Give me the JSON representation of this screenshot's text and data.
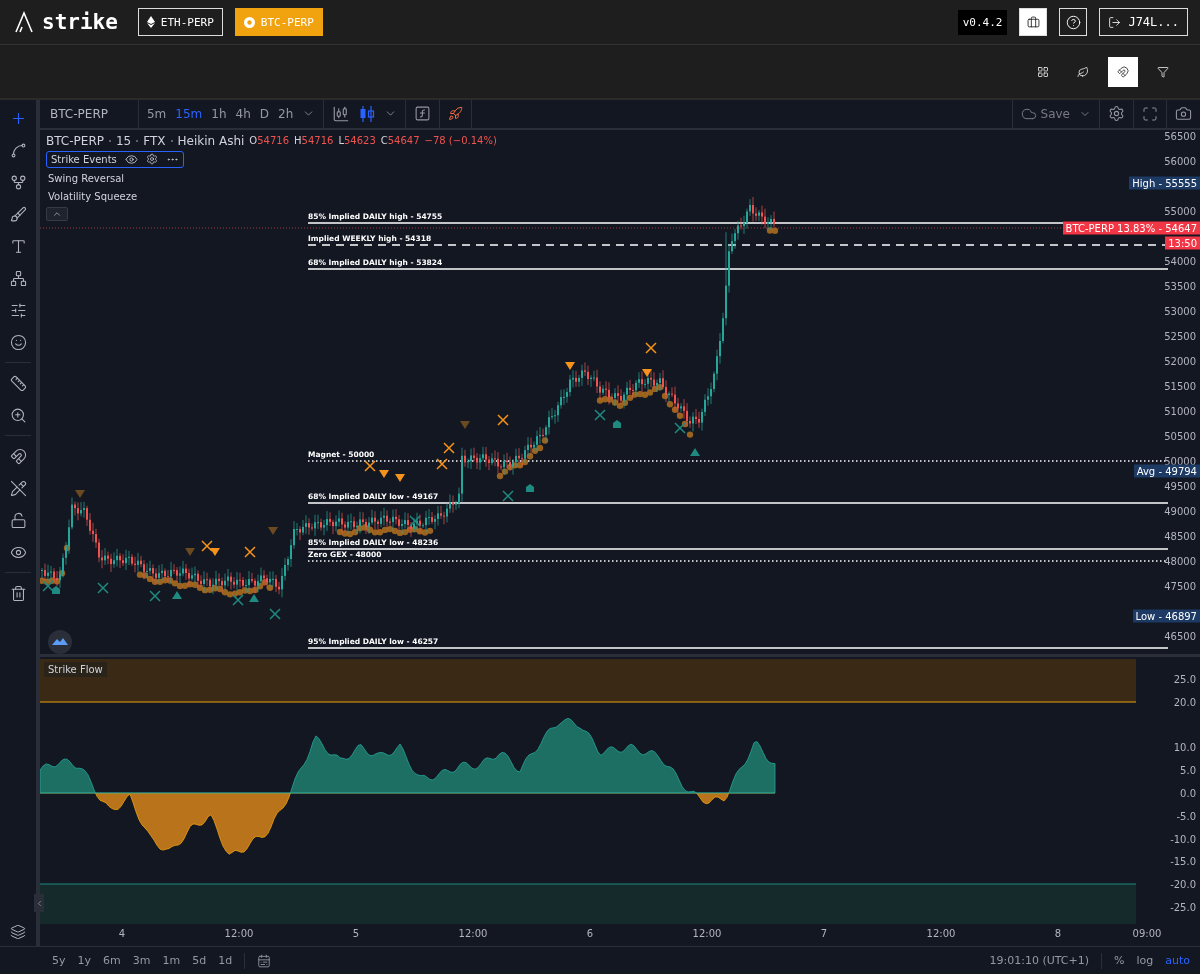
{
  "header": {
    "logo": "strike",
    "markets": [
      {
        "kind": "eth",
        "label": "ETH-PERP",
        "selected": false
      },
      {
        "kind": "btc",
        "label": "BTC-PERP",
        "selected": true
      }
    ],
    "version": "v0.4.2",
    "account": "J74L..."
  },
  "subbar": {
    "tools": [
      {
        "kind": "grid",
        "selected": false
      },
      {
        "kind": "leaf",
        "selected": false
      },
      {
        "kind": "magnet",
        "selected": true
      },
      {
        "kind": "filter",
        "selected": false
      }
    ]
  },
  "left_tools": [
    {
      "kind": "crosshair",
      "selected": true
    },
    {
      "kind": "trend-line",
      "selected": false
    },
    {
      "kind": "pitchfork",
      "selected": false
    },
    {
      "kind": "brush",
      "selected": false
    },
    {
      "kind": "text",
      "selected": false
    },
    {
      "kind": "pattern",
      "selected": false
    },
    {
      "kind": "forecast",
      "selected": false
    },
    {
      "kind": "emoji",
      "selected": false
    },
    {
      "kind": "ruler",
      "selected": false
    },
    {
      "kind": "zoom",
      "selected": false
    },
    {
      "kind": "magnet",
      "selected": false
    },
    {
      "kind": "lock-drawing",
      "selected": false
    },
    {
      "kind": "lock",
      "selected": false
    },
    {
      "kind": "eye",
      "selected": false
    },
    {
      "kind": "trash",
      "selected": false
    }
  ],
  "chart_toolbar": {
    "symbol": "BTC-PERP",
    "intervals": [
      {
        "label": "5m",
        "selected": false
      },
      {
        "label": "15m",
        "selected": true
      },
      {
        "label": "1h",
        "selected": false
      },
      {
        "label": "4h",
        "selected": false
      },
      {
        "label": "D",
        "selected": false
      },
      {
        "label": "2h",
        "selected": false
      }
    ],
    "chart_types": [
      {
        "kind": "candles",
        "selected": false
      },
      {
        "kind": "heikin-ashi",
        "selected": true
      }
    ],
    "save": "Save"
  },
  "legend": {
    "symbol": "BTC-PERP",
    "interval": "15",
    "exchange": "FTX",
    "chart_type": "Heikin Ashi",
    "ohlc": [
      {
        "key": "O",
        "value": "54716"
      },
      {
        "key": "H",
        "value": "54716"
      },
      {
        "key": "L",
        "value": "54623"
      },
      {
        "key": "C",
        "value": "54647"
      }
    ],
    "change": "−78 (−0.14%)",
    "indicators": [
      "Strike Events",
      "Swing Reversal",
      "Volatility Squeeze"
    ]
  },
  "levels": [
    {
      "kind": "solid",
      "label": "85% Implied DAILY high - 54755"
    },
    {
      "kind": "dashed",
      "label": "Implied WEEKLY high - 54318"
    },
    {
      "kind": "solid",
      "label": "68% Implied DAILY high - 53824"
    },
    {
      "kind": "dotted",
      "label": "Magnet - 50000"
    },
    {
      "kind": "solid",
      "label": "68% Implied DAILY low - 49167"
    },
    {
      "kind": "solid",
      "label": "85% Implied DAILY low - 48236"
    },
    {
      "kind": "dotted",
      "label": "Zero GEX - 48000"
    },
    {
      "kind": "solid",
      "label": "95% Implied DAILY low - 46257"
    }
  ],
  "price_axis": {
    "ticks": [
      "56500",
      "56000",
      "55000",
      "54000",
      "53500",
      "53000",
      "52500",
      "52000",
      "51500",
      "51000",
      "50500",
      "50000",
      "49500",
      "49000",
      "48500",
      "48000",
      "47500",
      "46500"
    ],
    "badges": [
      {
        "label": "High",
        "separator": "-",
        "value": "55555"
      },
      {
        "label": "Avg",
        "separator": "-",
        "value": "49794"
      },
      {
        "label": "Low",
        "separator": "-",
        "value": "46897"
      }
    ],
    "last": {
      "label": "BTC-PERP 13.83%",
      "separator": "-",
      "value": "54647",
      "countdown": "13:50"
    }
  },
  "oscillator": {
    "title": "Strike Flow",
    "ticks": [
      "25.0",
      "20.0",
      "10.0",
      "5.0",
      "0.0",
      "-5.0",
      "-10.0",
      "-15.0",
      "-20.0",
      "-25.0"
    ]
  },
  "time_axis": [
    "4",
    "12:00",
    "5",
    "12:00",
    "6",
    "12:00",
    "7",
    "12:00",
    "8",
    "09:00"
  ],
  "bottom_bar": {
    "ranges": [
      "5y",
      "1y",
      "6m",
      "3m",
      "1m",
      "5d",
      "1d"
    ],
    "clock": "19:01:10 (UTC+1)",
    "toggles": [
      {
        "label": "%",
        "selected": false
      },
      {
        "label": "log",
        "selected": false
      },
      {
        "label": "auto",
        "selected": true
      }
    ]
  }
}
